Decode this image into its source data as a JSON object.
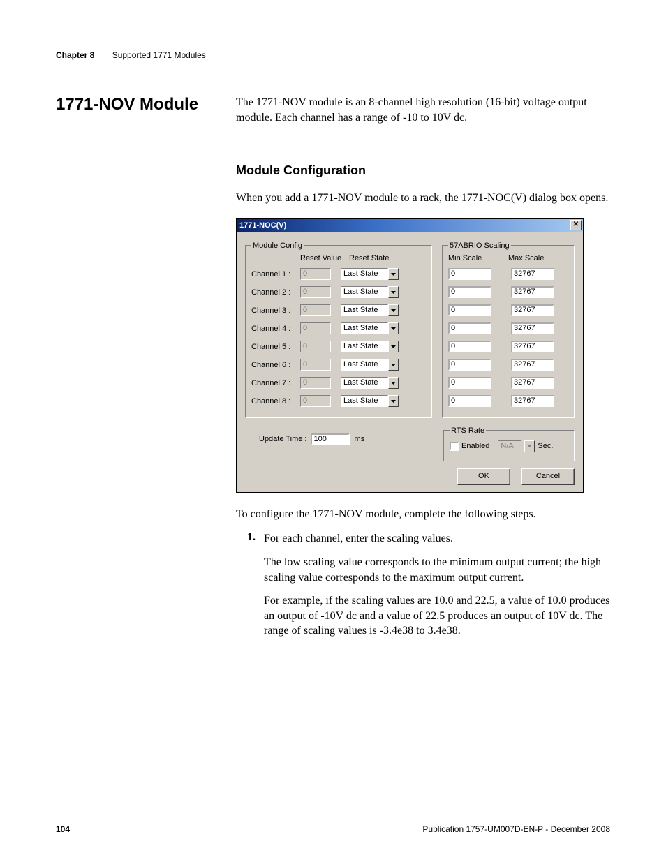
{
  "header": {
    "chapter_label": "Chapter 8",
    "chapter_title": "Supported 1771 Modules"
  },
  "title": "1771-NOV Module",
  "intro": "The 1771-NOV module is an 8-channel high resolution (16-bit) voltage output module. Each channel has a range of -10 to 10V dc.",
  "subtitle": "Module Configuration",
  "lead": "When you add a 1771-NOV module to a rack, the 1771-NOC(V) dialog box opens.",
  "dialog": {
    "title": "1771-NOC(V)",
    "close_glyph": "✕",
    "module_config_legend": "Module Config",
    "reset_value_label": "Reset Value",
    "reset_state_label": "Reset State",
    "channels": [
      {
        "label": "Channel 1 :",
        "reset_value": "0",
        "reset_state": "Last State",
        "min": "0",
        "max": "32767"
      },
      {
        "label": "Channel 2 :",
        "reset_value": "0",
        "reset_state": "Last State",
        "min": "0",
        "max": "32767"
      },
      {
        "label": "Channel 3 :",
        "reset_value": "0",
        "reset_state": "Last State",
        "min": "0",
        "max": "32767"
      },
      {
        "label": "Channel 4 :",
        "reset_value": "0",
        "reset_state": "Last State",
        "min": "0",
        "max": "32767"
      },
      {
        "label": "Channel 5 :",
        "reset_value": "0",
        "reset_state": "Last State",
        "min": "0",
        "max": "32767"
      },
      {
        "label": "Channel 6 :",
        "reset_value": "0",
        "reset_state": "Last State",
        "min": "0",
        "max": "32767"
      },
      {
        "label": "Channel 7 :",
        "reset_value": "0",
        "reset_state": "Last State",
        "min": "0",
        "max": "32767"
      },
      {
        "label": "Channel 8 :",
        "reset_value": "0",
        "reset_state": "Last State",
        "min": "0",
        "max": "32767"
      }
    ],
    "scaling_legend": "57ABRIO Scaling",
    "min_scale_label": "Min Scale",
    "max_scale_label": "Max Scale",
    "update_time_label": "Update Time :",
    "update_time_value": "100",
    "update_time_unit": "ms",
    "rts_legend": "RTS Rate",
    "rts_enabled_label": "Enabled",
    "rts_value": "N/A",
    "rts_unit": "Sec.",
    "ok_label": "OK",
    "cancel_label": "Cancel"
  },
  "after": {
    "steps_lead": "To configure the 1771-NOV module, complete the following steps.",
    "step1_num": "1.",
    "step1_text": "For each channel, enter the scaling values.",
    "step1_sub1": "The low scaling value corresponds to the minimum output current; the high scaling value corresponds to the maximum output current.",
    "step1_sub2": "For example, if the scaling values are 10.0 and 22.5, a value of 10.0 produces an output of -10V dc and a value of 22.5 produces an output of 10V dc. The range of scaling values is -3.4e38 to 3.4e38."
  },
  "footer": {
    "page": "104",
    "publication": "Publication 1757-UM007D-EN-P - December 2008"
  }
}
